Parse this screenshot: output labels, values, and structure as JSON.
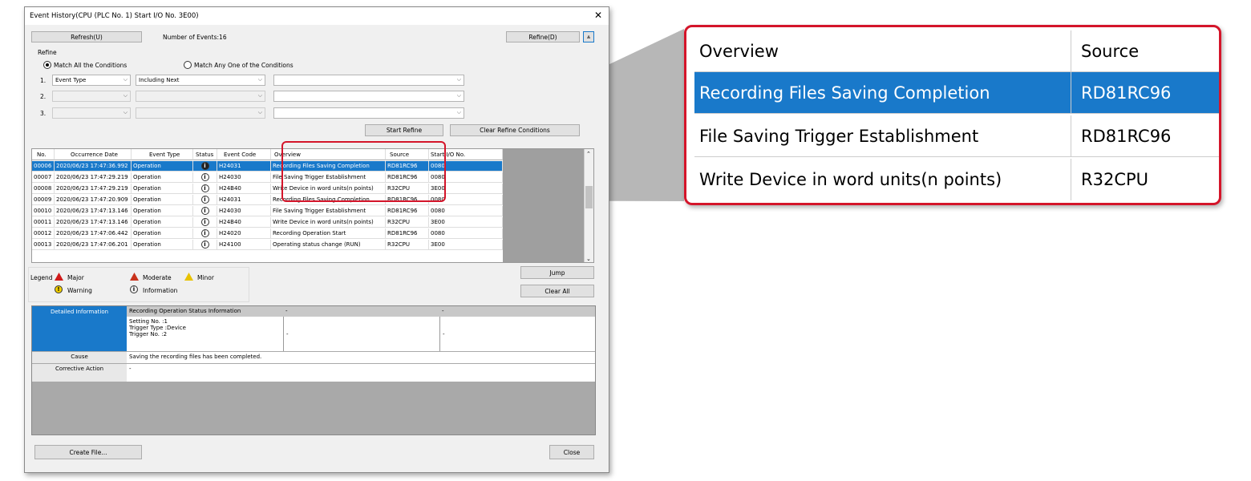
{
  "window": {
    "title": "Event History(CPU (PLC No. 1) Start I/O No. 3E00)",
    "close_glyph": "✕"
  },
  "toolbar": {
    "refresh_label": "Refresh(U)",
    "event_count": "Number of Events:16",
    "refine_label": "Refine(D)",
    "collapse_glyph": "⩓"
  },
  "refine": {
    "group_label": "Refine",
    "match_all": "Match All the Conditions",
    "match_any": "Match Any One of the Conditions",
    "rows": [
      {
        "num": "1.",
        "field": "Event Type",
        "op": "Including Next",
        "value": ""
      },
      {
        "num": "2.",
        "field": "",
        "op": "",
        "value": ""
      },
      {
        "num": "3.",
        "field": "",
        "op": "",
        "value": ""
      }
    ],
    "start_label": "Start Refine",
    "clear_label": "Clear Refine Conditions"
  },
  "table": {
    "headers": [
      "No.",
      "Occurrence Date",
      "Event Type",
      "Status",
      "Event Code",
      "Overview",
      "Source",
      "Start I/O No."
    ],
    "rows": [
      {
        "no": "00006",
        "date": "2020/06/23 17:47:36.992",
        "type": "Operation",
        "code": "H24031",
        "overview": "Recording Files Saving Completion",
        "source": "RD81RC96",
        "io": "0080",
        "selected": true
      },
      {
        "no": "00007",
        "date": "2020/06/23 17:47:29.219",
        "type": "Operation",
        "code": "H24030",
        "overview": "File Saving Trigger Establishment",
        "source": "RD81RC96",
        "io": "0080"
      },
      {
        "no": "00008",
        "date": "2020/06/23 17:47:29.219",
        "type": "Operation",
        "code": "H24B40",
        "overview": "Write Device in word units(n points)",
        "source": "R32CPU",
        "io": "3E00"
      },
      {
        "no": "00009",
        "date": "2020/06/23 17:47:20.909",
        "type": "Operation",
        "code": "H24031",
        "overview": "Recording Files Saving Completion",
        "source": "RD81RC96",
        "io": "0080"
      },
      {
        "no": "00010",
        "date": "2020/06/23 17:47:13.146",
        "type": "Operation",
        "code": "H24030",
        "overview": "File Saving Trigger Establishment",
        "source": "RD81RC96",
        "io": "0080"
      },
      {
        "no": "00011",
        "date": "2020/06/23 17:47:13.146",
        "type": "Operation",
        "code": "H24B40",
        "overview": "Write Device in word units(n points)",
        "source": "R32CPU",
        "io": "3E00"
      },
      {
        "no": "00012",
        "date": "2020/06/23 17:47:06.442",
        "type": "Operation",
        "code": "H24020",
        "overview": "Recording Operation Start",
        "source": "RD81RC96",
        "io": "0080"
      },
      {
        "no": "00013",
        "date": "2020/06/23 17:47:06.201",
        "type": "Operation",
        "code": "H24100",
        "overview": "Operating status change (RUN)",
        "source": "R32CPU",
        "io": "3E00"
      }
    ],
    "status_glyph": "i"
  },
  "side": {
    "jump_label": "Jump",
    "clear_all_label": "Clear All"
  },
  "legend": {
    "title": "Legend",
    "major": "Major",
    "moderate": "Moderate",
    "minor": "Minor",
    "warning": "Warning",
    "information": "Information",
    "warn_glyph": "!",
    "info_glyph": "i"
  },
  "detail": {
    "detailed_label": "Detailed Information",
    "col1": "Recording Operation Status Information",
    "col2": "-",
    "col3": "-",
    "line1": "Setting No. :1",
    "line2": "Trigger Type :Device",
    "line3": "Trigger No. :2",
    "val2": "-",
    "val3": "-",
    "cause_label": "Cause",
    "cause_text": "Saving the recording files has been completed.",
    "corrective_label": "Corrective Action",
    "corrective_text": "-"
  },
  "footer": {
    "create_label": "Create File...",
    "close_label": "Close"
  },
  "zoom": {
    "headers": [
      "Overview",
      "Source"
    ],
    "rows": [
      {
        "overview": "Recording Files Saving Completion",
        "source": "RD81RC96"
      },
      {
        "overview": "File Saving Trigger Establishment",
        "source": "RD81RC96"
      },
      {
        "overview": "Write Device in word units(n points)",
        "source": "R32CPU"
      }
    ]
  },
  "colors": {
    "selection": "#1979ca",
    "highlight": "#d4152a"
  }
}
